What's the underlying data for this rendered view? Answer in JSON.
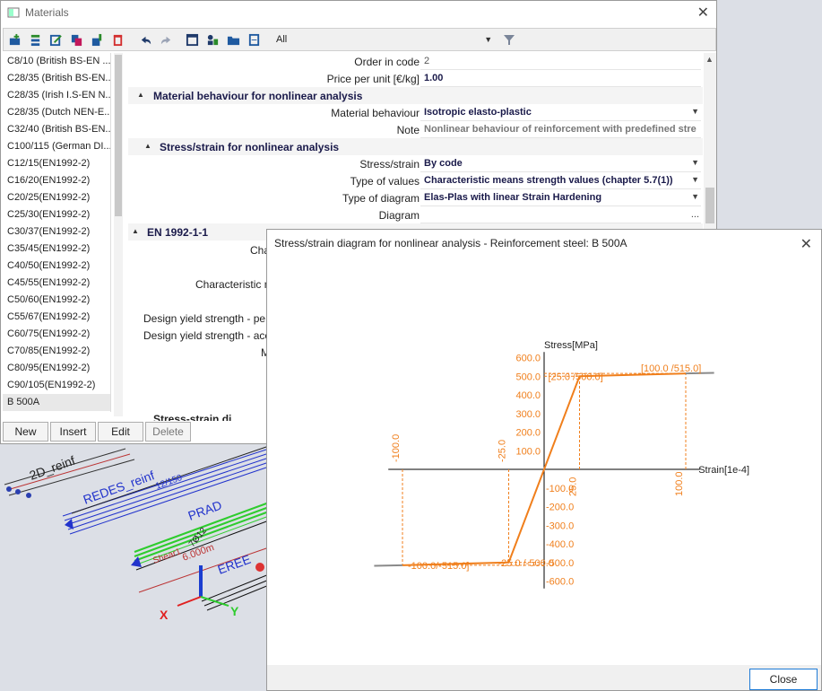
{
  "window": {
    "title": "Materials",
    "filter_value": "All",
    "toolbar_icons": [
      "new-material-icon",
      "insert-icon",
      "edit-icon",
      "copy-icon",
      "import-icon",
      "delete-icon",
      "undo-icon",
      "redo-icon",
      "library-icon",
      "users-icon",
      "open-folder-icon",
      "document-icon"
    ]
  },
  "materials_list": [
    "C8/10 (British BS-EN ...",
    "C28/35 (British BS-EN...",
    "C28/35 (Irish I.S-EN N...",
    "C28/35 (Dutch NEN-E...",
    "C32/40 (British BS-EN...",
    "C100/115 (German DI...",
    "C12/15(EN1992-2)",
    "C16/20(EN1992-2)",
    "C20/25(EN1992-2)",
    "C25/30(EN1992-2)",
    "C30/37(EN1992-2)",
    "C35/45(EN1992-2)",
    "C40/50(EN1992-2)",
    "C45/55(EN1992-2)",
    "C50/60(EN1992-2)",
    "C55/67(EN1992-2)",
    "C60/75(EN1992-2)",
    "C70/85(EN1992-2)",
    "C80/95(EN1992-2)",
    "C90/105(EN1992-2)",
    "B 500A"
  ],
  "buttons": {
    "new": "New",
    "insert": "Insert",
    "edit": "Edit",
    "delete": "Delete"
  },
  "properties": {
    "order_label": "Order in code",
    "order_value": "2",
    "price_label": "Price per unit [€/kg]",
    "price_value": "1.00",
    "section_behaviour": "Material behaviour for nonlinear analysis",
    "behaviour_label": "Material behaviour",
    "behaviour_value": "Isotropic elasto-plastic",
    "note_label": "Note",
    "note_value": "Nonlinear behaviour of reinforcement with predefined stre",
    "section_stress": "Stress/strain for nonlinear analysis",
    "stress_label": "Stress/strain",
    "stress_value": "By code",
    "type_values_label": "Type of values",
    "type_values_value": "Characteristic means strength values (chapter 5.7(1))",
    "type_diagram_label": "Type of diagram",
    "type_diagram_value": "Elas-Plas with linear Strain Hardening",
    "diagram_label": "Diagram",
    "diagram_btn": "...",
    "section_en": "EN 1992-1-1",
    "partial_1": "Cha",
    "partial_2": "Characteristic m",
    "partial_3": "Design yield strength - pers",
    "partial_4": "Design yield strength - acci",
    "partial_5": "M",
    "partial_6": "Stress-strain di"
  },
  "dialog": {
    "title": "Stress/strain diagram for nonlinear analysis - Reinforcement steel: B 500A",
    "close_label": "Close"
  },
  "background_labels": {
    "label_2d": "2D_reinf",
    "label_redes": "REDES_reinf",
    "label_12_150": "12/150",
    "label_prad": "PRAD",
    "label_7_12": "7Ø12",
    "label_shear": "Shear1",
    "label_6m": "6.000m",
    "label_eree": "EREE",
    "label_x": "X",
    "label_y": "Y"
  },
  "chart_data": {
    "type": "line",
    "ylabel": "Stress[MPa]",
    "xlabel": "Strain[1e-4]",
    "xlim": [
      -120,
      120
    ],
    "ylim": [
      -600,
      600
    ],
    "y_ticks": [
      600,
      500,
      400,
      300,
      200,
      100,
      -100,
      -200,
      -300,
      -400,
      -500,
      -600
    ],
    "x_ticks": [
      -100,
      -25,
      25,
      100
    ],
    "series": [
      {
        "x": [
          -120,
          -100,
          -25,
          0,
          25,
          100,
          120
        ],
        "y": [
          -518,
          -515,
          -500,
          0,
          500,
          515,
          518
        ]
      }
    ],
    "annotations": [
      "[25.0 /500.0]",
      "[100.0 /515.0]",
      "-25.0 /-500.0",
      "-100.0/-515.0]"
    ],
    "colors": {
      "curve": "#f07f1c",
      "extension": "#8a8a8a",
      "axis_text": "#f07f1c"
    }
  }
}
